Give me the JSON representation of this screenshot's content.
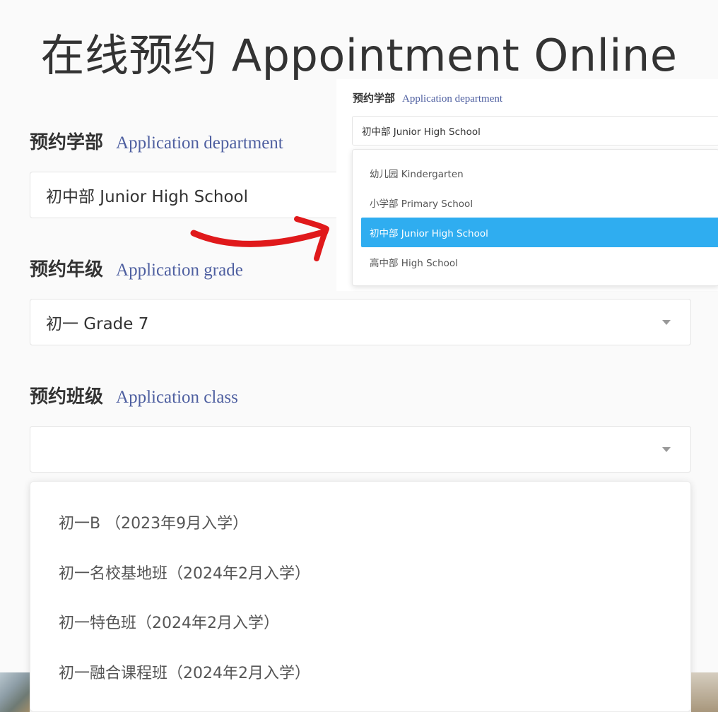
{
  "page": {
    "title": "在线预约 Appointment Online"
  },
  "form": {
    "department": {
      "label_zh": "预约学部",
      "label_en": "Application department",
      "value": "初中部 Junior High School"
    },
    "grade": {
      "label_zh": "预约年级",
      "label_en": "Application grade",
      "value": "初一 Grade 7"
    },
    "class": {
      "label_zh": "预约班级",
      "label_en": "Application class",
      "value": "",
      "options": [
        "初一B （2023年9月入学）",
        "初一名校基地班（2024年2月入学）",
        "初一特色班（2024年2月入学）",
        "初一融合课程班（2024年2月入学）"
      ]
    }
  },
  "inset": {
    "label_zh": "预约学部",
    "label_en": "Application department",
    "value": "初中部 Junior High School",
    "options": [
      "幼儿园 Kindergarten",
      "小学部 Primary School",
      "初中部 Junior High School",
      "高中部 High School"
    ],
    "selected_index": 2
  },
  "colors": {
    "accent_label": "#4e5fa0",
    "selected_option_bg": "#2fadf0",
    "annotation_arrow": "#e0191b"
  }
}
